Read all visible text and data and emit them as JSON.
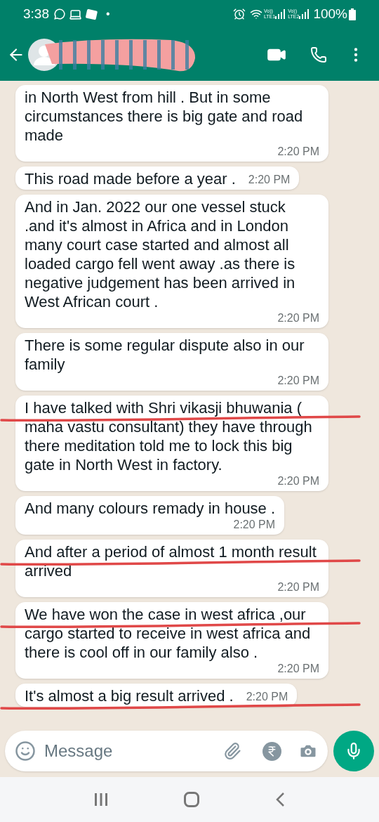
{
  "status_bar": {
    "time": "3:38",
    "dot": "•",
    "sim1": "Vo))\nLTE1",
    "sim2": "Vo))\nLTE2",
    "battery": "100%"
  },
  "header": {
    "redacted": true
  },
  "messages": [
    {
      "kind": "long",
      "text": "in North West from hill . But in some circumstances there is big gate and road made",
      "time": "2:20 PM",
      "underlined": false
    },
    {
      "kind": "short",
      "text": "This road made before a year .",
      "time": "2:20 PM",
      "underlined": false
    },
    {
      "kind": "long",
      "text": "And in Jan. 2022 our one vessel stuck .and it's almost in Africa and in London many court case started and almost all loaded cargo fell went away .as there is negative judgement has been arrived in West African court .",
      "time": "2:20 PM",
      "underlined": false
    },
    {
      "kind": "long",
      "text": "There is some regular dispute also in our family",
      "time": "2:20 PM",
      "underlined": false
    },
    {
      "kind": "long",
      "text": "I have talked with Shri vikasji bhuwania ( maha vastu consultant) they have through there meditation told me to lock this big gate in North West in factory.",
      "time": "2:20 PM",
      "underlined": true
    },
    {
      "kind": "long",
      "text": "And many colours remady in house .",
      "time": "2:20 PM",
      "underlined": false
    },
    {
      "kind": "long",
      "text": "And after a period of almost 1 month result arrived",
      "time": "2:20 PM",
      "underlined": true
    },
    {
      "kind": "long",
      "text": "We have won the case in west africa ,our cargo started to receive in west africa and there is cool off in our family also .",
      "time": "2:20 PM",
      "underlined": true
    },
    {
      "kind": "short",
      "text": "It's almost a big result arrived .",
      "time": "2:20 PM",
      "underlined": true
    }
  ],
  "composer": {
    "placeholder": "Message"
  }
}
